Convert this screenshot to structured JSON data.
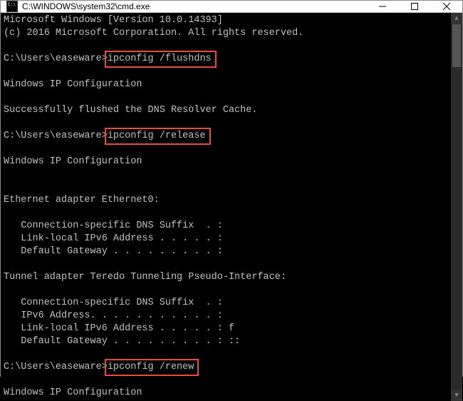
{
  "titlebar": {
    "title": "C:\\WINDOWS\\system32\\cmd.exe"
  },
  "colors": {
    "highlight_border": "#e74c3c",
    "terminal_fg": "#c0c0c0",
    "terminal_bg": "#000000"
  },
  "terminal": {
    "line_version": "Microsoft Windows [Version 10.0.14393]",
    "line_copyright": "(c) 2016 Microsoft Corporation. All rights reserved.",
    "prompt1_prefix": "C:\\Users\\easeware>",
    "prompt1_cmd": "ipconfig /flushdns",
    "heading_ipconfig": "Windows IP Configuration",
    "line_flush_ok": "Successfully flushed the DNS Resolver Cache.",
    "prompt2_prefix": "C:\\Users\\easeware>",
    "prompt2_cmd": "ipconfig /release",
    "eth_header": "Ethernet adapter Ethernet0:",
    "eth_dns": "   Connection-specific DNS Suffix  . :",
    "eth_ipv6": "   Link-local IPv6 Address . . . . . :",
    "eth_gw": "   Default Gateway . . . . . . . . . :",
    "tun_header": "Tunnel adapter Teredo Tunneling Pseudo-Interface:",
    "tun_dns": "   Connection-specific DNS Suffix  . :",
    "tun_ip": "   IPv6 Address. . . . . . . . . . . :",
    "tun_ll": "   Link-local IPv6 Address . . . . . : f",
    "tun_gw": "   Default Gateway . . . . . . . . . : ::",
    "prompt3_prefix": "C:\\Users\\easeware>",
    "prompt3_cmd": "ipconfig /renew"
  }
}
